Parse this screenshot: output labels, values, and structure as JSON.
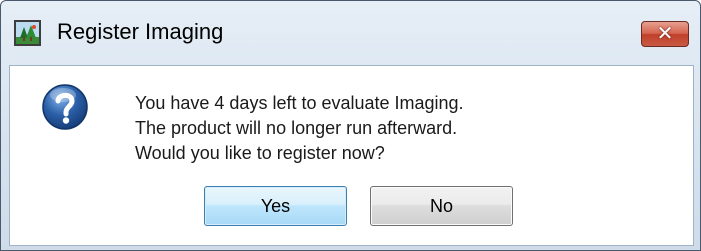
{
  "window": {
    "title": "Register Imaging",
    "app_icon": "imaging-app-icon",
    "close_label": "✕"
  },
  "dialog": {
    "icon": "question-icon",
    "message_lines": [
      "You have 4 days left to evaluate Imaging.",
      "The product will no longer run afterward.",
      "Would you like to register now?"
    ],
    "buttons": {
      "yes_label": "Yes",
      "no_label": "No",
      "default": "Yes"
    }
  },
  "colors": {
    "question_icon": "#2b5fa8",
    "close_button": "#c0402a",
    "default_button_border": "#3c7fb1"
  }
}
